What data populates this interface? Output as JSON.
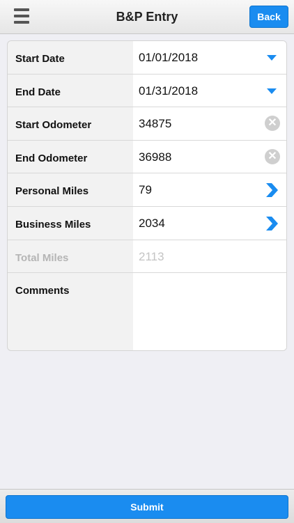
{
  "header": {
    "title": "B&P Entry",
    "back_label": "Back",
    "menu_icon": "hamburger-menu-icon"
  },
  "form": {
    "rows": [
      {
        "label": "Start Date",
        "value": "01/01/2018",
        "control": "dropdown-arrow-icon"
      },
      {
        "label": "End Date",
        "value": "01/31/2018",
        "control": "dropdown-arrow-icon"
      },
      {
        "label": "Start Odometer",
        "value": "34875",
        "control": "clear-icon"
      },
      {
        "label": "End Odometer",
        "value": "36988",
        "control": "clear-icon"
      },
      {
        "label": "Personal Miles",
        "value": "79",
        "control": "chevron-right-icon"
      },
      {
        "label": "Business Miles",
        "value": "2034",
        "control": "chevron-right-icon"
      },
      {
        "label": "Total Miles",
        "value": "2113",
        "disabled": true
      },
      {
        "label": "Comments",
        "value": ""
      }
    ]
  },
  "footer": {
    "submit_label": "Submit"
  },
  "colors": {
    "accent": "#1a8cf0",
    "background": "#efeff4",
    "disabled_text": "#c4c4c4"
  }
}
